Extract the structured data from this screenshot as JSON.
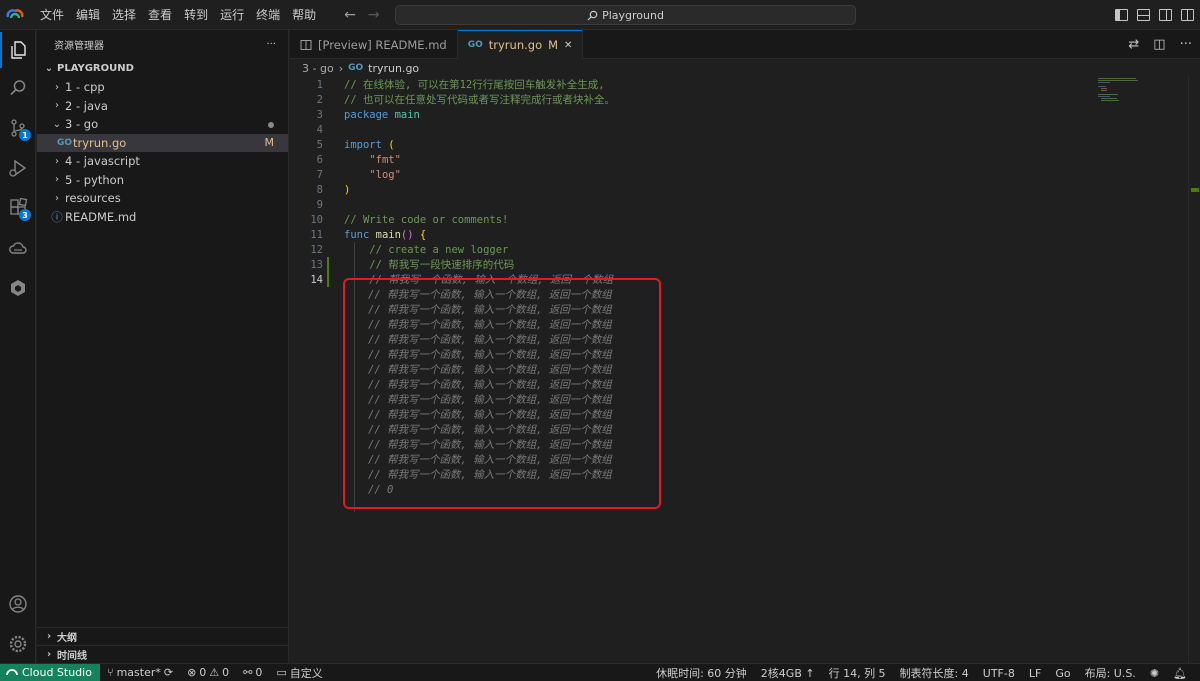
{
  "menu": [
    "文件",
    "编辑",
    "选择",
    "查看",
    "转到",
    "运行",
    "终端",
    "帮助"
  ],
  "search": {
    "text": "Playground"
  },
  "sidebar": {
    "title": "资源管理器",
    "more": "···",
    "section": "PLAYGROUND",
    "items": [
      {
        "label": "1 - cpp"
      },
      {
        "label": "2 - java"
      },
      {
        "label": "3 - go"
      },
      {
        "label": "tryrun.go",
        "status": "M"
      },
      {
        "label": "4 - javascript"
      },
      {
        "label": "5 - python"
      },
      {
        "label": "resources"
      },
      {
        "label": "README.md"
      }
    ],
    "outline": "大纲",
    "timeline": "时间线"
  },
  "activity": {
    "scm_badge": "1",
    "ext_badge": "3"
  },
  "tabs": [
    {
      "label": "[Preview] README.md"
    },
    {
      "label": "tryrun.go",
      "status": "M",
      "close": "✕"
    }
  ],
  "breadcrumb": {
    "folder": "3 - go",
    "sep": "›",
    "file": "tryrun.go"
  },
  "editor": {
    "lines": [
      {
        "n": "1",
        "parts": [
          [
            "c-comment",
            "// 在线体验, 可以在第12行行尾按回车触发补全生成,"
          ]
        ]
      },
      {
        "n": "2",
        "parts": [
          [
            "c-comment",
            "// 也可以在任意处写代码或者写注释完成行或者块补全。"
          ]
        ]
      },
      {
        "n": "3",
        "parts": [
          [
            "c-kw",
            "package"
          ],
          [
            "",
            " "
          ],
          [
            "c-pkg",
            "main"
          ]
        ]
      },
      {
        "n": "4",
        "parts": []
      },
      {
        "n": "5",
        "parts": [
          [
            "c-kw",
            "import"
          ],
          [
            "",
            " "
          ],
          [
            "c-paren",
            "("
          ]
        ]
      },
      {
        "n": "6",
        "parts": [
          [
            "",
            "    "
          ],
          [
            "c-str",
            "\"fmt\""
          ]
        ]
      },
      {
        "n": "7",
        "parts": [
          [
            "",
            "    "
          ],
          [
            "c-str",
            "\"log\""
          ]
        ]
      },
      {
        "n": "8",
        "parts": [
          [
            "c-paren",
            ")"
          ]
        ]
      },
      {
        "n": "9",
        "parts": []
      },
      {
        "n": "10",
        "parts": [
          [
            "c-comment",
            "// Write code or comments!"
          ]
        ]
      },
      {
        "n": "11",
        "parts": [
          [
            "c-kw",
            "func"
          ],
          [
            "",
            " "
          ],
          [
            "c-fn",
            "main"
          ],
          [
            "c-brace",
            "()"
          ],
          [
            "",
            " "
          ],
          [
            "c-paren",
            "{"
          ]
        ]
      },
      {
        "n": "12",
        "parts": [
          [
            "",
            "    "
          ],
          [
            "c-comment",
            "// create a new logger"
          ]
        ]
      },
      {
        "n": "13",
        "parts": [
          [
            "",
            "    "
          ],
          [
            "c-comment",
            "// 帮我写一段快速排序的代码"
          ]
        ]
      },
      {
        "n": "14",
        "parts": [
          [
            "",
            "    "
          ],
          [
            "c-ghost",
            "// 帮我写一个函数, 输入一个数组, 返回一个数组"
          ]
        ]
      }
    ],
    "ghost_lines": [
      "// 帮我写一个函数, 输入一个数组, 返回一个数组",
      "// 帮我写一个函数, 输入一个数组, 返回一个数组",
      "// 帮我写一个函数, 输入一个数组, 返回一个数组",
      "// 帮我写一个函数, 输入一个数组, 返回一个数组",
      "// 帮我写一个函数, 输入一个数组, 返回一个数组",
      "// 帮我写一个函数, 输入一个数组, 返回一个数组",
      "// 帮我写一个函数, 输入一个数组, 返回一个数组",
      "// 帮我写一个函数, 输入一个数组, 返回一个数组",
      "// 帮我写一个函数, 输入一个数组, 返回一个数组",
      "// 帮我写一个函数, 输入一个数组, 返回一个数组",
      "// 帮我写一个函数, 输入一个数组, 返回一个数组",
      "// 帮我写一个函数, 输入一个数组, 返回一个数组",
      "// 帮我写一个函数, 输入一个数组, 返回一个数组",
      "// 0"
    ]
  },
  "status": {
    "remote": "Cloud Studio",
    "branch": "master*",
    "errors": "0",
    "warnings": "0",
    "ports": "0",
    "custom": "自定义",
    "sleep": "休眠时间: 60 分钟",
    "machine": "2核4GB ↑",
    "position": "行 14, 列 5",
    "tab_size": "制表符长度: 4",
    "encoding": "UTF-8",
    "eol": "LF",
    "language": "Go",
    "layout": "布局: U.S."
  },
  "colors": {
    "accent": "#0078d4",
    "remote": "#16825d",
    "highlight": "#e01b24"
  }
}
